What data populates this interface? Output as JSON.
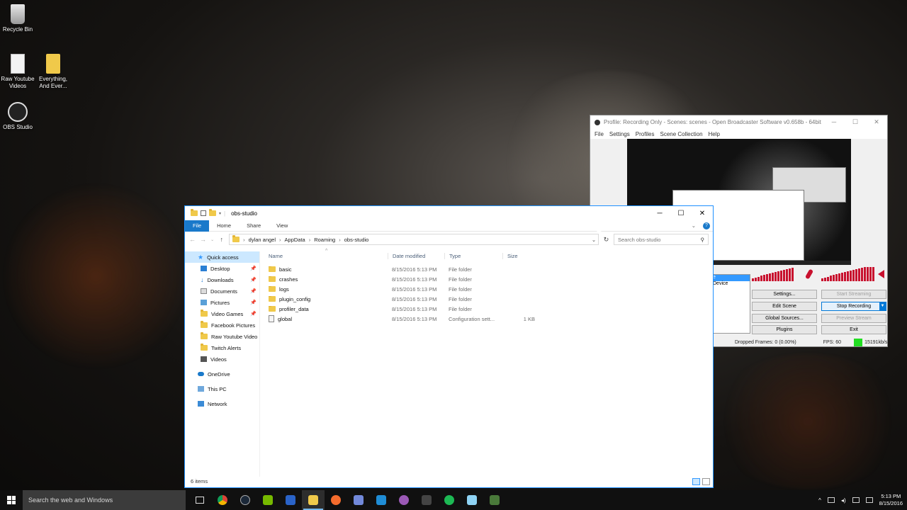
{
  "desktop": {
    "icons": [
      {
        "label": "Recycle Bin",
        "icon": "recycle-bin-icon"
      },
      {
        "label": "Raw Youtube Videos",
        "icon": "document-icon"
      },
      {
        "label": "Everything, And Ever...",
        "icon": "folder-icon"
      },
      {
        "label": "OBS Studio",
        "icon": "obs-icon"
      }
    ]
  },
  "obs": {
    "title": "Profile: Recording Only - Scenes: scenes - Open Broadcaster Software v0.658b - 64bit",
    "menu": [
      "File",
      "Settings",
      "Profiles",
      "Scene Collection",
      "Help"
    ],
    "scenes_items": [
      "e",
      "Device"
    ],
    "buttons": {
      "settings": "Settings...",
      "start_streaming": "Start Streaming",
      "edit_scene": "Edit Scene",
      "stop_recording": "Stop Recording",
      "global_sources": "Global Sources...",
      "preview_stream": "Preview Stream",
      "plugins": "Plugins",
      "exit": "Exit"
    },
    "status": {
      "dropped": "Dropped Frames: 0 (0.00%)",
      "fps": "FPS: 60",
      "bitrate": "15191kb/s",
      "bitrate_color": "#22dd22"
    },
    "meter_color": "#c8102e"
  },
  "explorer": {
    "title": "obs-studio",
    "ribbon": [
      "File",
      "Home",
      "Share",
      "View"
    ],
    "address": [
      "dylan angel",
      "AppData",
      "Roaming",
      "obs-studio"
    ],
    "search_placeholder": "Search obs-studio",
    "nav": [
      {
        "label": "Quick access",
        "icon": "star-icon",
        "head": true,
        "selected": true
      },
      {
        "label": "Desktop",
        "icon": "desktop-icon",
        "pinned": true
      },
      {
        "label": "Downloads",
        "icon": "download-icon",
        "pinned": true
      },
      {
        "label": "Documents",
        "icon": "documents-icon",
        "pinned": true
      },
      {
        "label": "Pictures",
        "icon": "pictures-icon",
        "pinned": true
      },
      {
        "label": "Video Games",
        "icon": "folder-icon",
        "pinned": true
      },
      {
        "label": "Facebook Pictures",
        "icon": "folder-icon"
      },
      {
        "label": "Raw Youtube Video",
        "icon": "folder-icon"
      },
      {
        "label": "Twitch Alerts",
        "icon": "folder-icon"
      },
      {
        "label": "Videos",
        "icon": "videos-icon"
      },
      {
        "label": "OneDrive",
        "icon": "onedrive-icon",
        "head": true
      },
      {
        "label": "This PC",
        "icon": "pc-icon",
        "head": true
      },
      {
        "label": "Network",
        "icon": "network-icon",
        "head": true
      }
    ],
    "columns": {
      "name": "Name",
      "date": "Date modified",
      "type": "Type",
      "size": "Size"
    },
    "files": [
      {
        "name": "basic",
        "date": "8/15/2016 5:13 PM",
        "type": "File folder",
        "size": "",
        "kind": "folder"
      },
      {
        "name": "crashes",
        "date": "8/15/2016 5:13 PM",
        "type": "File folder",
        "size": "",
        "kind": "folder"
      },
      {
        "name": "logs",
        "date": "8/15/2016 5:13 PM",
        "type": "File folder",
        "size": "",
        "kind": "folder"
      },
      {
        "name": "plugin_config",
        "date": "8/15/2016 5:13 PM",
        "type": "File folder",
        "size": "",
        "kind": "folder"
      },
      {
        "name": "profiler_data",
        "date": "8/15/2016 5:13 PM",
        "type": "File folder",
        "size": "",
        "kind": "folder"
      },
      {
        "name": "global",
        "date": "8/15/2016 5:13 PM",
        "type": "Configuration sett...",
        "size": "1 KB",
        "kind": "config"
      }
    ],
    "status": "6 items"
  },
  "taskbar": {
    "search_placeholder": "Search the web and Windows",
    "apps": [
      {
        "icon": "task-view-icon",
        "color": "#101010"
      },
      {
        "icon": "chrome-icon",
        "color": "#db4437"
      },
      {
        "icon": "steam-icon",
        "color": "#1b2838"
      },
      {
        "icon": "nvidia-icon",
        "color": "#76b900"
      },
      {
        "icon": "malwarebytes-icon",
        "color": "#2a63c8"
      },
      {
        "icon": "file-explorer-icon",
        "color": "#f0c94a",
        "active": true
      },
      {
        "icon": "origin-icon",
        "color": "#f56c2d"
      },
      {
        "icon": "discord-icon",
        "color": "#7289da"
      },
      {
        "icon": "app-icon",
        "color": "#1f8dd6"
      },
      {
        "icon": "app-icon",
        "color": "#9b59b6"
      },
      {
        "icon": "app-icon",
        "color": "#444444"
      },
      {
        "icon": "spotify-icon",
        "color": "#1db954"
      },
      {
        "icon": "app-icon",
        "color": "#8fd3f4"
      },
      {
        "icon": "app-icon",
        "color": "#4a7a3a"
      }
    ],
    "time": "5:13 PM",
    "date": "8/15/2016"
  }
}
